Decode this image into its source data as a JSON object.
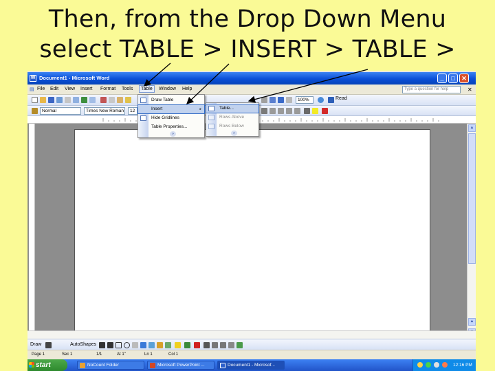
{
  "headline": {
    "line1": "Then, from the Drop Down Menu",
    "line2": "select TABLE > INSERT > TABLE >"
  },
  "window": {
    "title": "Document1 - Microsoft Word",
    "min_glyph": "_",
    "max_glyph": "□",
    "close_glyph": "✕"
  },
  "menubar": {
    "items": [
      "File",
      "Edit",
      "View",
      "Insert",
      "Format",
      "Tools",
      "Table",
      "Window",
      "Help"
    ],
    "active_index": 6,
    "help_placeholder": "Type a question for help",
    "close_doc_glyph": "✕"
  },
  "toolbar": {
    "zoom_value": "100%",
    "read_label": "Read",
    "style_value": "Normal",
    "font_value": "Times New Roman",
    "font_size_value": "12"
  },
  "table_menu": {
    "items": [
      "Draw Table",
      "Insert",
      "Hide Gridlines",
      "Table Properties..."
    ],
    "highlight_index": 1,
    "submenu_arrow": "▸",
    "expand_glyph": "»"
  },
  "insert_submenu": {
    "items": [
      "Table...",
      "Rows Above",
      "Rows Below"
    ],
    "highlight_index": 0,
    "expand_glyph": "»"
  },
  "drawing_toolbar": {
    "draw_label": "Draw",
    "autoshapes_label": "AutoShapes"
  },
  "statusbar": {
    "page": "Page 1",
    "sec": "Sec 1",
    "page_of": "1/1",
    "at": "At 1\"",
    "ln": "Ln 1",
    "col": "Col 1"
  },
  "taskbar": {
    "start_label": "start",
    "tasks": [
      "NoCount Folder",
      "Microsoft PowerPoint ...",
      "Document1 - Microsof..."
    ],
    "pressed_index": 2,
    "clock": "12:16 PM"
  },
  "colors": {
    "slide_background": "#fafa96",
    "title_bar_blue": "#0a4fd8",
    "menu_highlight": "#c1d2ee",
    "start_green": "#3a9a3a",
    "arrow_color": "#000000"
  }
}
